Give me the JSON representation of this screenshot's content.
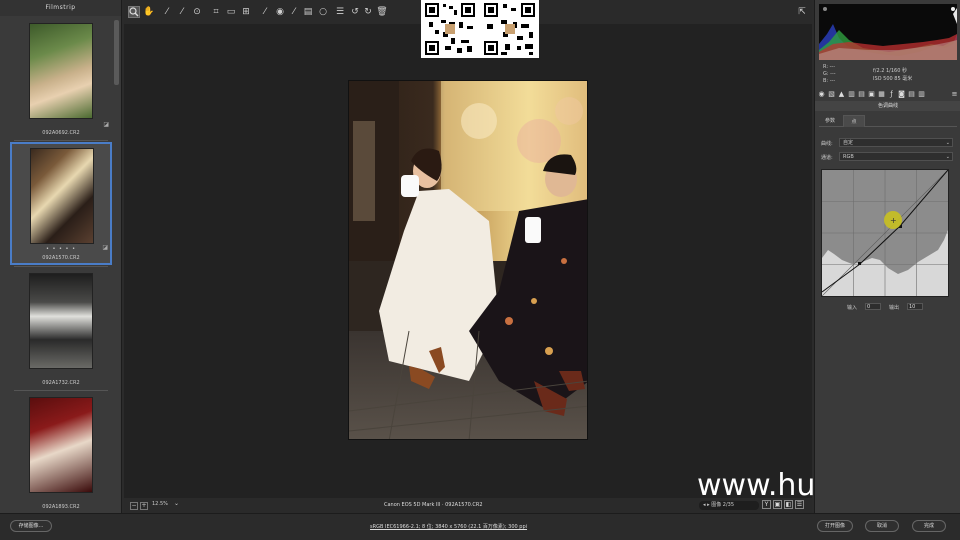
{
  "filmstrip": {
    "title": "Filmstrip",
    "items": [
      {
        "label": "092A0692.CR2",
        "selected": false,
        "stars": ""
      },
      {
        "label": "092A1570.CR2",
        "selected": true,
        "stars": "• • • • •"
      },
      {
        "label": "092A1732.CR2",
        "selected": false,
        "stars": ""
      },
      {
        "label": "092A1893.CR2",
        "selected": false,
        "stars": ""
      }
    ]
  },
  "toolbar": {
    "tools": [
      "zoom-icon",
      "hand-icon",
      "white-balance-icon",
      "color-sampler-icon",
      "target-adjust-icon",
      "crop-icon",
      "straighten-icon",
      "transform-icon",
      "spot-removal-icon",
      "red-eye-icon",
      "adjustment-brush-icon",
      "graduated-filter-icon",
      "radial-filter-icon",
      "preferences-icon",
      "rotate-left-icon",
      "rotate-right-icon",
      "trash-icon"
    ],
    "fullscreen_icon": "fullscreen-icon"
  },
  "status": {
    "zoom": "12.5%",
    "camera": "Canon EOS 5D Mark III · 092A1570.CR2",
    "image_nav": "图像 2/35",
    "view_buttons": [
      "Y",
      "▣",
      "◧",
      "☰"
    ]
  },
  "watermark": "www.hunls.com",
  "right_panel": {
    "readouts": {
      "r": "R: ---",
      "g": "G: ---",
      "b": "B: ---",
      "aperture_shutter": "f/2.2  1/160 秒",
      "iso_focal": "ISO 500  85 毫米"
    },
    "section_title": "色调曲线",
    "subtabs": [
      "参数",
      "点"
    ],
    "curve_label": "曲线:",
    "curve_value": "自定",
    "channel_label": "通道:",
    "channel_value": "RGB",
    "input_label": "输入",
    "input_value": "0",
    "output_label": "输出",
    "output_value": "10"
  },
  "bottombar": {
    "save_label": "存储图像...",
    "workflow": "sRGB IEC61966-2.1; 8 位; 3840 x 5760 (22.1 百万像素); 300 ppi",
    "open_label": "打开图像",
    "cancel_label": "取消",
    "done_label": "完成"
  },
  "colors": {
    "accent": "#4a7dc8",
    "panel": "#3a3a3a",
    "canvas": "#222222"
  }
}
